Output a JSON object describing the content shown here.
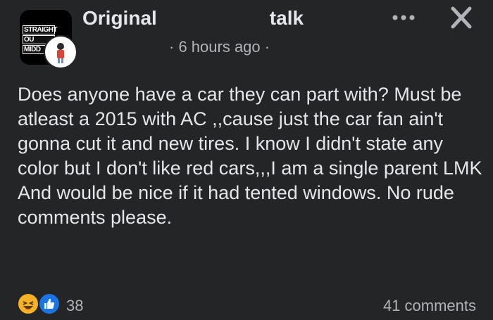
{
  "post": {
    "group_name": "Original",
    "group_name_suffix": "talk",
    "group_logo_lines": [
      "STRAIGHT",
      "OU",
      "MIDD"
    ],
    "timestamp": "6 hours ago",
    "separator_left": "·",
    "separator_right": "·",
    "more_icon": "more-dots-icon",
    "close_icon": "close-icon",
    "body": "Does anyone have a car they can part with? Must be atleast a 2015 with AC ,,cause just the car fan ain't gonna cut it and new tires. I know I didn't state any color but I don't like red cars,,,I am a single parent LMK And would be nice if it had tented windows. No rude comments please.",
    "reaction_count": "38",
    "comment_count": "41 comments",
    "reactions": [
      "haha",
      "like"
    ]
  },
  "colors": {
    "background": "#242526",
    "primary_text": "#e4e6eb",
    "secondary_text": "#b0b3b8",
    "like_blue": "#1b74e4",
    "haha_yellow": "#f7b125"
  }
}
